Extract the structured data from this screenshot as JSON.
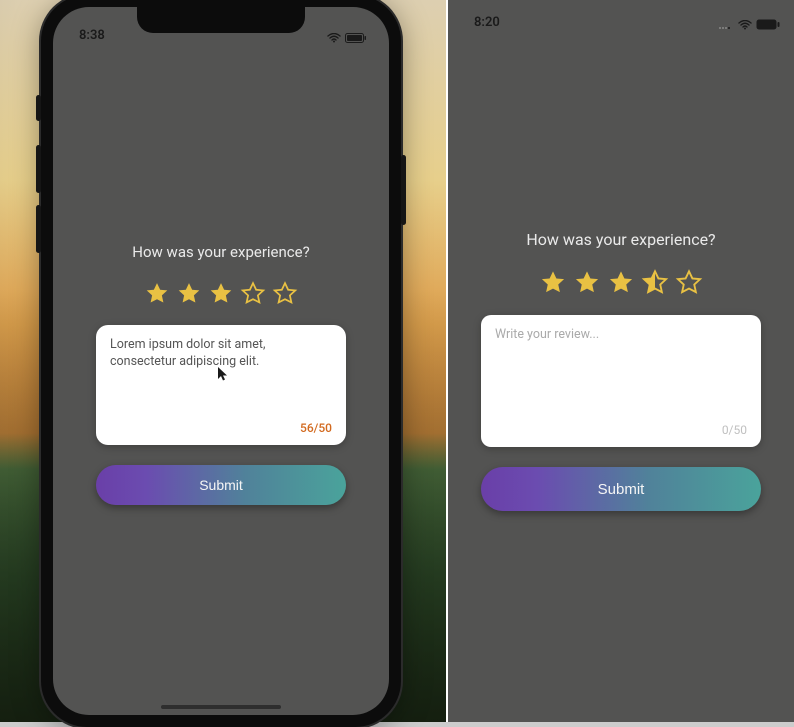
{
  "left": {
    "status_time": "8:38",
    "title": "How was your experience?",
    "rating_value": 3,
    "rating_max": 5,
    "review_text": "Lorem ipsum dolor sit amet, consectetur adipiscing elit.",
    "char_count": 56,
    "char_limit": 50,
    "counter_label": "56/50",
    "over_limit": true,
    "submit_label": "Submit"
  },
  "right": {
    "status_time": "8:20",
    "title": "How was your experience?",
    "rating_value": 3.5,
    "rating_max": 5,
    "review_text": "",
    "review_placeholder": "Write your review...",
    "char_count": 0,
    "char_limit": 50,
    "counter_label": "0/50",
    "over_limit": false,
    "submit_label": "Submit"
  },
  "colors": {
    "star_fill": "#e9c143",
    "star_stroke": "#e9c143",
    "star_empty_stroke": "#e9c143"
  }
}
